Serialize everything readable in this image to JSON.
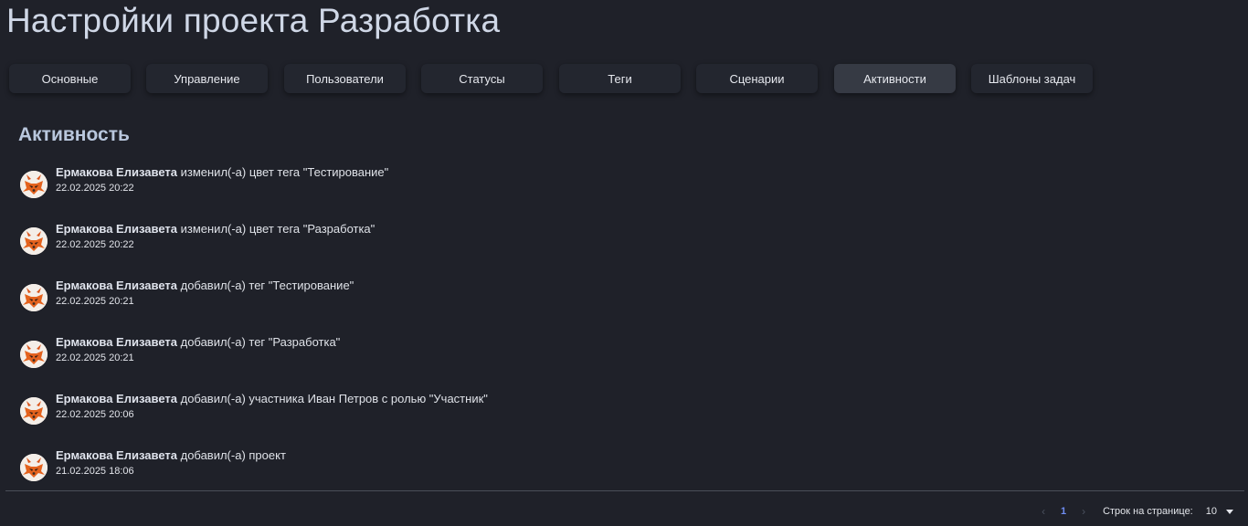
{
  "page": {
    "title": "Настройки проекта Разработка"
  },
  "tabs": [
    {
      "label": "Основные"
    },
    {
      "label": "Управление"
    },
    {
      "label": "Пользователи"
    },
    {
      "label": "Статусы"
    },
    {
      "label": "Теги"
    },
    {
      "label": "Сценарии"
    },
    {
      "label": "Активности",
      "active": true
    },
    {
      "label": "Шаблоны задач"
    }
  ],
  "section": {
    "title": "Активность"
  },
  "activities": [
    {
      "user": "Ермакова Елизавета",
      "action": "изменил(-а) цвет тега \"Тестирование\"",
      "date": "22.02.2025 20:22"
    },
    {
      "user": "Ермакова Елизавета",
      "action": "изменил(-а) цвет тега \"Разработка\"",
      "date": "22.02.2025 20:22"
    },
    {
      "user": "Ермакова Елизавета",
      "action": "добавил(-а) тег \"Тестирование\"",
      "date": "22.02.2025 20:21"
    },
    {
      "user": "Ермакова Елизавета",
      "action": "добавил(-а) тег \"Разработка\"",
      "date": "22.02.2025 20:21"
    },
    {
      "user": "Ермакова Елизавета",
      "action": "добавил(-а) участника Иван Петров с ролью \"Участник\"",
      "date": "22.02.2025 20:06"
    },
    {
      "user": "Ермакова Елизавета",
      "action": "добавил(-а) проект",
      "date": "21.02.2025 18:06"
    }
  ],
  "pagination": {
    "prev_icon": "chevron-left-icon",
    "current_page": "1",
    "next_icon": "chevron-right-icon",
    "rows_label": "Строк на странице:",
    "rows_value": "10"
  },
  "colors": {
    "background": "#1f2129",
    "tab": "#23262f",
    "tab_active": "#363a44",
    "accent": "#6f8df2"
  }
}
